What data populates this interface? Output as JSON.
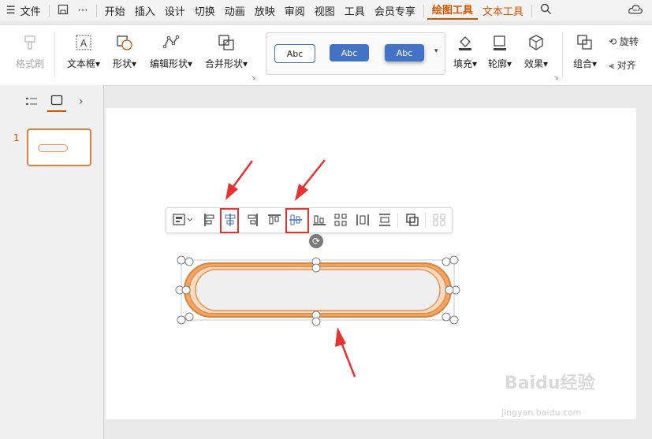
{
  "menubar": {
    "file": "文件",
    "tabs": [
      "开始",
      "插入",
      "设计",
      "切换",
      "动画",
      "放映",
      "审阅",
      "视图",
      "工具",
      "会员专享"
    ],
    "context_tabs": [
      "绘图工具",
      "文本工具"
    ]
  },
  "ribbon": {
    "format_painter": "格式刷",
    "text_box": "文本框",
    "shape": "形状",
    "edit_shape": "编辑形状",
    "merge_shape": "合并形状",
    "style_samples": [
      "Abc",
      "Abc",
      "Abc"
    ],
    "fill": "填充",
    "outline": "轮廓",
    "effect": "效果",
    "group": "组合",
    "rotate": "旋转",
    "align": "对齐"
  },
  "slides": {
    "number": "1"
  },
  "watermark": {
    "brand": "Baidu经验",
    "url": "jingyan.baidu.com"
  },
  "colors": {
    "accent": "#d35400",
    "shape_outline": "#e8934f",
    "shape_fill": "#efefef",
    "annotation_red": "#e8322f"
  }
}
